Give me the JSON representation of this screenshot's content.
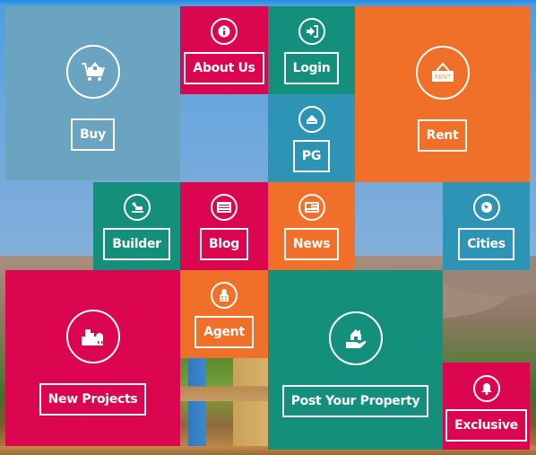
{
  "tiles": {
    "buy": {
      "label": "Buy",
      "icon": "shopping-cart-house-icon",
      "color": "#6aa4c0"
    },
    "about": {
      "label": "About Us",
      "icon": "info-icon",
      "color": "#dc0650"
    },
    "login": {
      "label": "Login",
      "icon": "sign-in-icon",
      "color": "#148f7c"
    },
    "rent": {
      "label": "Rent",
      "icon": "rent-sign-icon",
      "icon_text": "RENT",
      "color": "#f0702a"
    },
    "pg": {
      "label": "PG",
      "icon": "hostel-bed-icon",
      "color": "#2e94b6"
    },
    "builder": {
      "label": "Builder",
      "icon": "excavator-icon",
      "color": "#148f7c"
    },
    "blog": {
      "label": "Blog",
      "icon": "blog-list-icon",
      "color": "#dc0650"
    },
    "news": {
      "label": "News",
      "icon": "newspaper-icon",
      "color": "#f0702a"
    },
    "cities": {
      "label": "Cities",
      "icon": "globe-icon",
      "color": "#2e94b6"
    },
    "new_projects": {
      "label": "New Projects",
      "icon": "building-construction-icon",
      "color": "#dc0650"
    },
    "agent": {
      "label": "Agent",
      "icon": "agent-badge-icon",
      "color": "#f0702a"
    },
    "post_property": {
      "label": "Post Your Property",
      "icon": "house-in-hand-icon",
      "color": "#148f7c"
    },
    "exclusive": {
      "label": "Exclusive",
      "icon": "bell-icon",
      "color": "#dc0650"
    }
  }
}
